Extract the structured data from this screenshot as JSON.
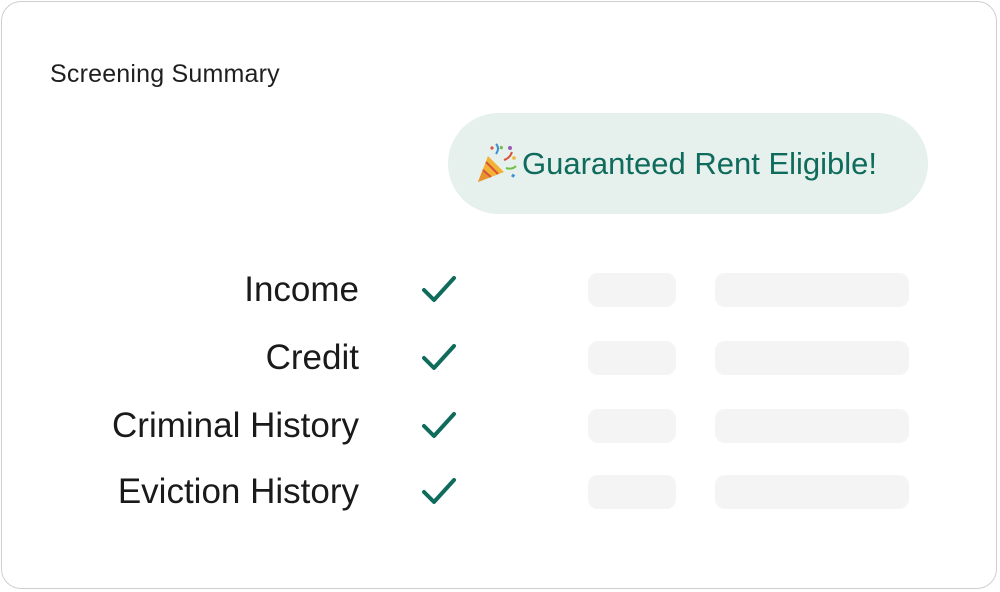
{
  "summary": {
    "title": "Screening Summary",
    "badge": {
      "icon": "party-popper-icon",
      "text": "Guaranteed Rent Eligible!"
    },
    "checks": [
      {
        "label": "Income",
        "status": "passed",
        "icon": "check-icon"
      },
      {
        "label": "Credit",
        "status": "passed",
        "icon": "check-icon"
      },
      {
        "label": "Criminal History",
        "status": "passed",
        "icon": "check-icon"
      },
      {
        "label": "Eviction History",
        "status": "passed",
        "icon": "check-icon"
      }
    ]
  },
  "colors": {
    "accent": "#0f6b5c",
    "badge_background": "#e6f0ed",
    "placeholder": "#f4f4f4",
    "text": "#1a1a1a"
  }
}
